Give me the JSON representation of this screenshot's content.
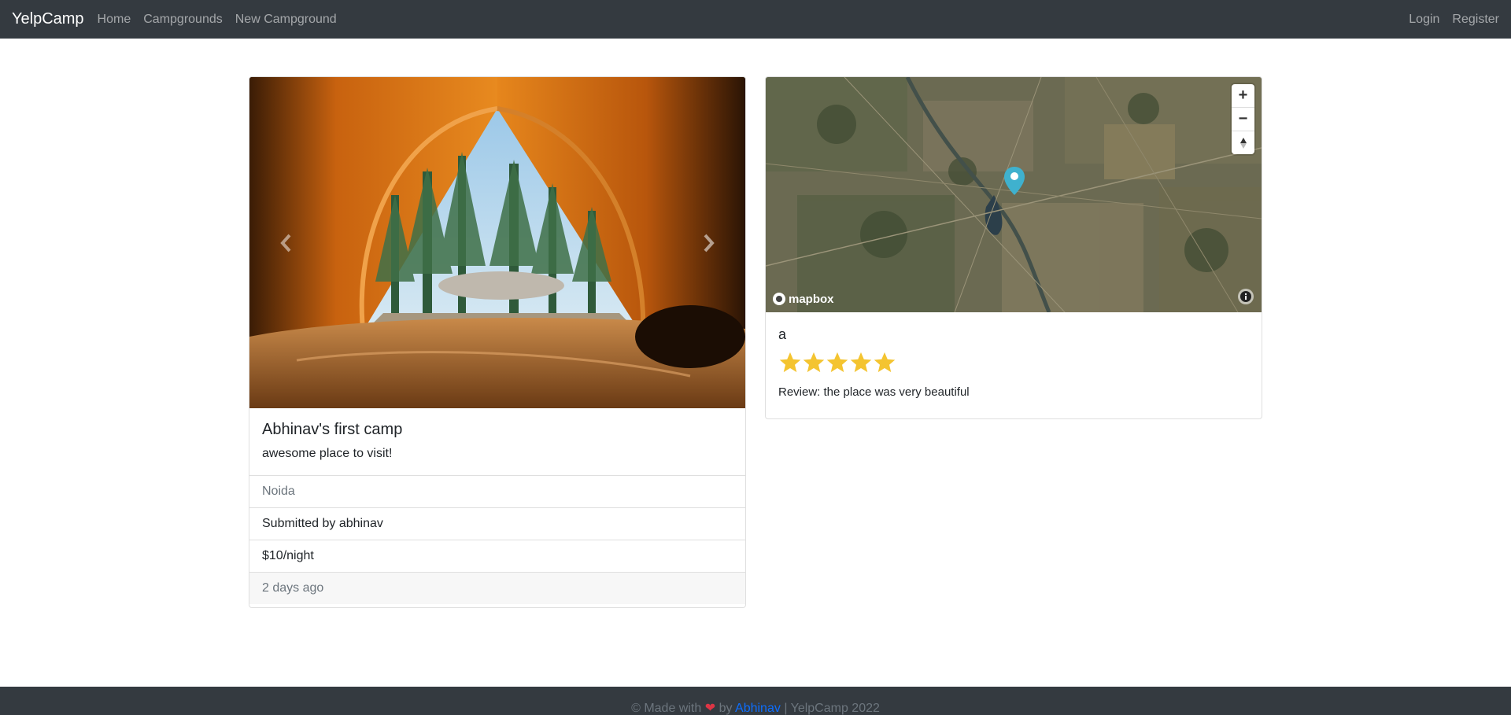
{
  "nav": {
    "brand": "YelpCamp",
    "links": [
      "Home",
      "Campgrounds",
      "New Campground"
    ],
    "right_links": [
      "Login",
      "Register"
    ]
  },
  "campground": {
    "title": "Abhinav's first camp",
    "description": "awesome place to visit!",
    "location": "Noida",
    "submitted_by": "Submitted by abhinav",
    "price": "$10/night",
    "time_ago": "2 days ago"
  },
  "map": {
    "zoom_in": "+",
    "zoom_out": "−",
    "logo": "mapbox"
  },
  "review": {
    "title": "a",
    "rating": 5,
    "rating_max": 5,
    "text": "Review: the place was very beautiful"
  },
  "footer": {
    "prefix": "© Made with",
    "heart": "❤",
    "by": "by",
    "author": "Abhinav",
    "suffix": "| YelpCamp 2022"
  },
  "colors": {
    "navbar": "#343a40",
    "star": "#f4c430",
    "link": "#0d6efd",
    "marker": "#3fb1ce"
  }
}
